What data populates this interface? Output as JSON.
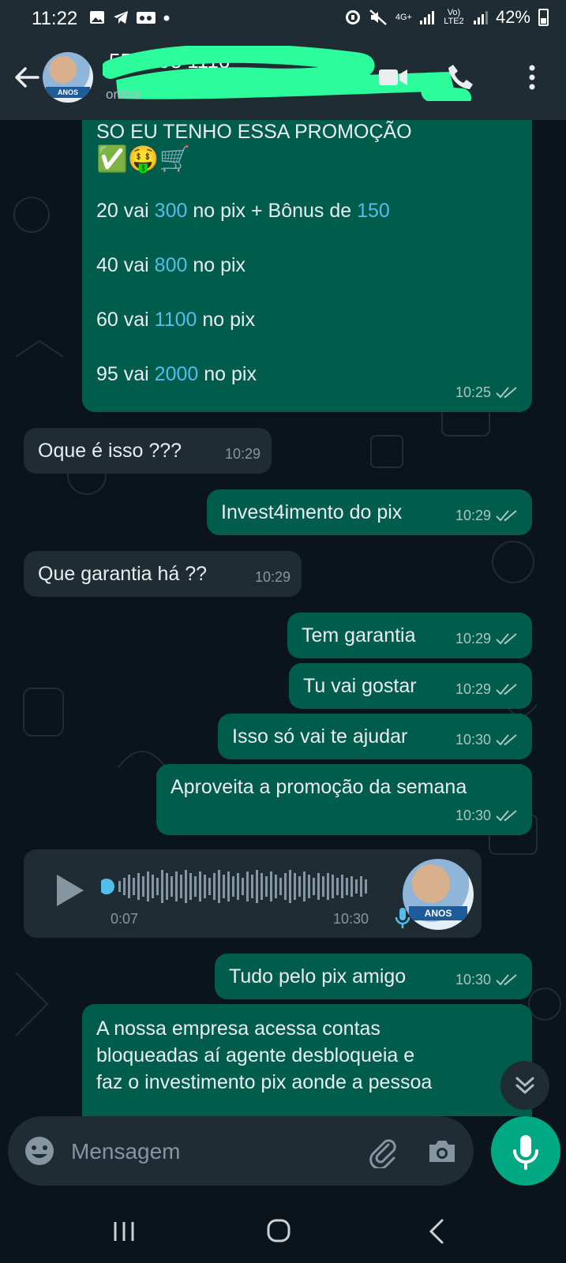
{
  "status_bar": {
    "time": "11:22",
    "network_label": "4G+",
    "volte_label": "Vo) LTE2",
    "battery": "42%"
  },
  "header": {
    "contact_name": "5511 98 1116",
    "contact_status": "online",
    "avatar_badge": "ANOS"
  },
  "messages": [
    {
      "direction": "out",
      "lines": [
        "SO EU TENHO ESSA PROMOÇÃO",
        "✅🤑🛒"
      ],
      "promo": [
        {
          "pre": "20 vai ",
          "num": "300",
          "mid": " no pix + Bônus de ",
          "num2": "150"
        },
        {
          "pre": "40 vai ",
          "num": "800",
          "mid": " no pix"
        },
        {
          "pre": "60 vai ",
          "num": "1100",
          "mid": " no pix"
        },
        {
          "pre": "95 vai ",
          "num": "2000",
          "mid": " no pix"
        }
      ],
      "time": "10:25",
      "read": true
    },
    {
      "direction": "in",
      "text": "Oque é isso ???",
      "time": "10:29"
    },
    {
      "direction": "out",
      "text": "Invest4imento do pix",
      "time": "10:29",
      "read": true
    },
    {
      "direction": "in",
      "text": "Que garantia há ??",
      "time": "10:29"
    },
    {
      "direction": "out",
      "text": "Tem garantia",
      "time": "10:29",
      "read": true
    },
    {
      "direction": "out",
      "text": "Tu vai gostar",
      "time": "10:29",
      "read": true
    },
    {
      "direction": "out",
      "text": "Isso só vai te ajudar",
      "time": "10:30",
      "read": true
    },
    {
      "direction": "out",
      "text": "Aproveita a promoção da semana",
      "time": "10:30",
      "read": true
    },
    {
      "direction": "in",
      "type": "voice",
      "duration": "0:07",
      "time": "10:30",
      "avatar_badge": "ANOS"
    },
    {
      "direction": "out",
      "text": "Tudo pelo pix amigo",
      "time": "10:30",
      "read": true
    },
    {
      "direction": "out",
      "text_lines": [
        "A nossa empresa acessa contas",
        "bloqueadas aí agente desbloqueia e",
        "faz o investimento pix aonde a pessoa"
      ]
    }
  ],
  "input": {
    "placeholder": "Mensagem"
  },
  "icons": {
    "back": "arrow-left-icon",
    "video": "video-call-icon",
    "call": "phone-icon",
    "menu": "more-vert-icon",
    "emoji": "emoji-icon",
    "attach": "paperclip-icon",
    "camera": "camera-icon",
    "mic": "microphone-icon"
  },
  "colors": {
    "outgoing_bubble": "#005c4b",
    "incoming_bubble": "#1f2c34",
    "accent": "#00a884",
    "number_highlight": "#53bdeb",
    "background": "#0b141a"
  }
}
